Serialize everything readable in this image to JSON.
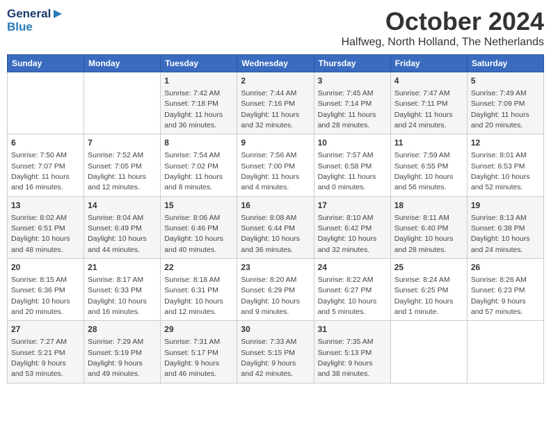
{
  "logo": {
    "line1": "General",
    "line2": "Blue"
  },
  "header": {
    "month": "October 2024",
    "location": "Halfweg, North Holland, The Netherlands"
  },
  "weekdays": [
    "Sunday",
    "Monday",
    "Tuesday",
    "Wednesday",
    "Thursday",
    "Friday",
    "Saturday"
  ],
  "weeks": [
    {
      "days": [
        null,
        null,
        {
          "date": "1",
          "sunrise": "7:42 AM",
          "sunset": "7:18 PM",
          "daylight": "11 hours and 36 minutes."
        },
        {
          "date": "2",
          "sunrise": "7:44 AM",
          "sunset": "7:16 PM",
          "daylight": "11 hours and 32 minutes."
        },
        {
          "date": "3",
          "sunrise": "7:45 AM",
          "sunset": "7:14 PM",
          "daylight": "11 hours and 28 minutes."
        },
        {
          "date": "4",
          "sunrise": "7:47 AM",
          "sunset": "7:11 PM",
          "daylight": "11 hours and 24 minutes."
        },
        {
          "date": "5",
          "sunrise": "7:49 AM",
          "sunset": "7:09 PM",
          "daylight": "11 hours and 20 minutes."
        }
      ]
    },
    {
      "days": [
        {
          "date": "6",
          "sunrise": "7:50 AM",
          "sunset": "7:07 PM",
          "daylight": "11 hours and 16 minutes."
        },
        {
          "date": "7",
          "sunrise": "7:52 AM",
          "sunset": "7:05 PM",
          "daylight": "11 hours and 12 minutes."
        },
        {
          "date": "8",
          "sunrise": "7:54 AM",
          "sunset": "7:02 PM",
          "daylight": "11 hours and 8 minutes."
        },
        {
          "date": "9",
          "sunrise": "7:56 AM",
          "sunset": "7:00 PM",
          "daylight": "11 hours and 4 minutes."
        },
        {
          "date": "10",
          "sunrise": "7:57 AM",
          "sunset": "6:58 PM",
          "daylight": "11 hours and 0 minutes."
        },
        {
          "date": "11",
          "sunrise": "7:59 AM",
          "sunset": "6:55 PM",
          "daylight": "10 hours and 56 minutes."
        },
        {
          "date": "12",
          "sunrise": "8:01 AM",
          "sunset": "6:53 PM",
          "daylight": "10 hours and 52 minutes."
        }
      ]
    },
    {
      "days": [
        {
          "date": "13",
          "sunrise": "8:02 AM",
          "sunset": "6:51 PM",
          "daylight": "10 hours and 48 minutes."
        },
        {
          "date": "14",
          "sunrise": "8:04 AM",
          "sunset": "6:49 PM",
          "daylight": "10 hours and 44 minutes."
        },
        {
          "date": "15",
          "sunrise": "8:06 AM",
          "sunset": "6:46 PM",
          "daylight": "10 hours and 40 minutes."
        },
        {
          "date": "16",
          "sunrise": "8:08 AM",
          "sunset": "6:44 PM",
          "daylight": "10 hours and 36 minutes."
        },
        {
          "date": "17",
          "sunrise": "8:10 AM",
          "sunset": "6:42 PM",
          "daylight": "10 hours and 32 minutes."
        },
        {
          "date": "18",
          "sunrise": "8:11 AM",
          "sunset": "6:40 PM",
          "daylight": "10 hours and 28 minutes."
        },
        {
          "date": "19",
          "sunrise": "8:13 AM",
          "sunset": "6:38 PM",
          "daylight": "10 hours and 24 minutes."
        }
      ]
    },
    {
      "days": [
        {
          "date": "20",
          "sunrise": "8:15 AM",
          "sunset": "6:36 PM",
          "daylight": "10 hours and 20 minutes."
        },
        {
          "date": "21",
          "sunrise": "8:17 AM",
          "sunset": "6:33 PM",
          "daylight": "10 hours and 16 minutes."
        },
        {
          "date": "22",
          "sunrise": "8:18 AM",
          "sunset": "6:31 PM",
          "daylight": "10 hours and 12 minutes."
        },
        {
          "date": "23",
          "sunrise": "8:20 AM",
          "sunset": "6:29 PM",
          "daylight": "10 hours and 9 minutes."
        },
        {
          "date": "24",
          "sunrise": "8:22 AM",
          "sunset": "6:27 PM",
          "daylight": "10 hours and 5 minutes."
        },
        {
          "date": "25",
          "sunrise": "8:24 AM",
          "sunset": "6:25 PM",
          "daylight": "10 hours and 1 minute."
        },
        {
          "date": "26",
          "sunrise": "8:26 AM",
          "sunset": "6:23 PM",
          "daylight": "9 hours and 57 minutes."
        }
      ]
    },
    {
      "days": [
        {
          "date": "27",
          "sunrise": "7:27 AM",
          "sunset": "5:21 PM",
          "daylight": "9 hours and 53 minutes."
        },
        {
          "date": "28",
          "sunrise": "7:29 AM",
          "sunset": "5:19 PM",
          "daylight": "9 hours and 49 minutes."
        },
        {
          "date": "29",
          "sunrise": "7:31 AM",
          "sunset": "5:17 PM",
          "daylight": "9 hours and 46 minutes."
        },
        {
          "date": "30",
          "sunrise": "7:33 AM",
          "sunset": "5:15 PM",
          "daylight": "9 hours and 42 minutes."
        },
        {
          "date": "31",
          "sunrise": "7:35 AM",
          "sunset": "5:13 PM",
          "daylight": "9 hours and 38 minutes."
        },
        null,
        null
      ]
    }
  ]
}
